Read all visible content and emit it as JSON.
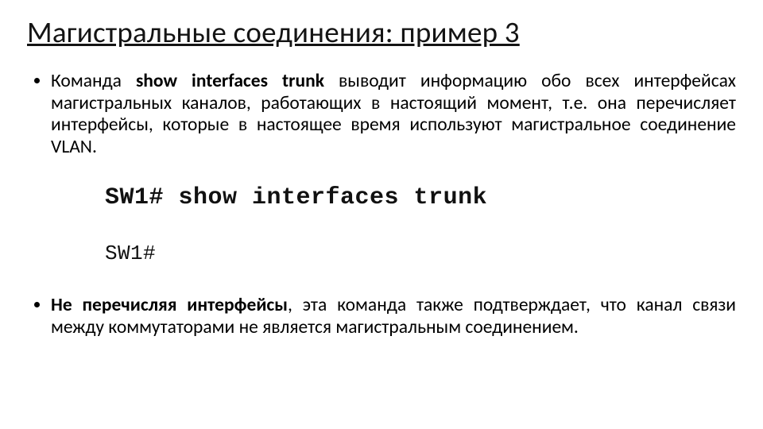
{
  "title": "Магистральные соединения: пример 3",
  "bullet1": {
    "lead": "Команда ",
    "cmd": "show interfaces trunk",
    "rest": " выводит информацию обо всех интерфейсах магистральных каналов, работающих в настоящий момент, т.е. она перечисляет интерфейсы, которые в настоящее время используют магистральное соединение VLAN."
  },
  "cli": {
    "line1": "SW1# show interfaces trunk",
    "line2": "SW1#"
  },
  "bullet2": {
    "lead": "Не перечисляя интерфейсы",
    "rest": ", эта команда также подтверждает, что канал связи между коммутаторами не является магистральным соединением."
  }
}
